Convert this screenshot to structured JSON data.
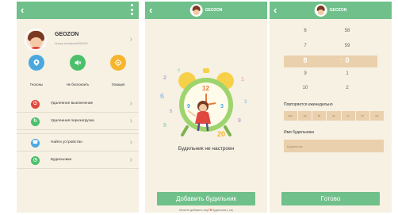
{
  "screen1": {
    "profile": {
      "name": "GEOZON",
      "phone": "Номер телефона0000000"
    },
    "quick_actions": [
      {
        "label": "Геозоны",
        "icon": "geofence-icon"
      },
      {
        "label": "Не беспокоить",
        "icon": "mute-speaker-icon"
      },
      {
        "label": "Локация",
        "icon": "location-icon"
      }
    ],
    "menu": [
      {
        "label": "Удаленное выключение",
        "icon": "power-icon",
        "color": "#e0473e"
      },
      {
        "label": "Удаленная перезагрузка",
        "icon": "restart-icon",
        "color": "#4cbf6b"
      },
      {
        "label": "Найти устройство",
        "icon": "find-device-icon",
        "color": "#4aa8df"
      },
      {
        "label": "Будильники",
        "icon": "alarm-icon",
        "color": "#4cbf6b"
      }
    ]
  },
  "screen2": {
    "header_title": "GEOZON",
    "empty_text": "Будильник не настроен",
    "add_button": "Добавить будильник",
    "hint_prefix": "Можете добавить ещё",
    "hint_count": "5",
    "hint_suffix": "будильник (-ов)"
  },
  "screen3": {
    "header_title": "GEOZON",
    "picker": {
      "hours_above": [
        "6",
        "7"
      ],
      "minutes_above": [
        "58",
        "59"
      ],
      "hour_selected": "8",
      "minute_selected": "0",
      "hours_below": [
        "9",
        "10"
      ],
      "minutes_below": [
        "1",
        "2"
      ]
    },
    "repeat_label": "Повторяется еженедельно",
    "days": [
      "Вск",
      "Пн",
      "Вт",
      "Ср",
      "Чт",
      "Пт",
      "Сб"
    ],
    "name_label": "Имя будильника",
    "name_placeholder": "Будильник",
    "done_button": "Готово"
  },
  "colors": {
    "accent": "#6fc08a",
    "background": "#f6f1e3",
    "highlight": "#ebd0ad",
    "red": "#e0473e",
    "blue": "#4aa8df",
    "yellow": "#f7b52c"
  }
}
